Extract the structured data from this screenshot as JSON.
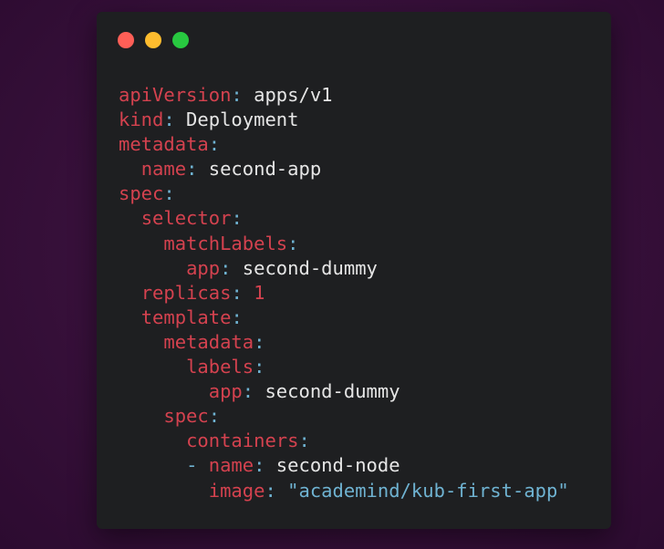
{
  "window": {
    "controls": {
      "close_color": "#fe5f57",
      "minimize_color": "#febc2e",
      "maximize_color": "#28c840"
    }
  },
  "code": {
    "colors": {
      "key": "#d4424f",
      "punct": "#6fb3d2",
      "value": "#e6e6e6",
      "string": "#6fb3d2",
      "number": "#d4424f"
    },
    "lines": [
      {
        "indent": "",
        "dash": "",
        "key": "apiVersion",
        "colon": ":",
        "value": " apps/v1",
        "vtype": "v"
      },
      {
        "indent": "",
        "dash": "",
        "key": "kind",
        "colon": ":",
        "value": " Deployment",
        "vtype": "v"
      },
      {
        "indent": "",
        "dash": "",
        "key": "metadata",
        "colon": ":",
        "value": "",
        "vtype": "v"
      },
      {
        "indent": "  ",
        "dash": "",
        "key": "name",
        "colon": ":",
        "value": " second-app",
        "vtype": "v"
      },
      {
        "indent": "",
        "dash": "",
        "key": "spec",
        "colon": ":",
        "value": "",
        "vtype": "v"
      },
      {
        "indent": "  ",
        "dash": "",
        "key": "selector",
        "colon": ":",
        "value": "",
        "vtype": "v"
      },
      {
        "indent": "    ",
        "dash": "",
        "key": "matchLabels",
        "colon": ":",
        "value": "",
        "vtype": "v"
      },
      {
        "indent": "      ",
        "dash": "",
        "key": "app",
        "colon": ":",
        "value": " second-dummy",
        "vtype": "v"
      },
      {
        "indent": "  ",
        "dash": "",
        "key": "replicas",
        "colon": ":",
        "value": " 1",
        "vtype": "n"
      },
      {
        "indent": "  ",
        "dash": "",
        "key": "template",
        "colon": ":",
        "value": "",
        "vtype": "v"
      },
      {
        "indent": "    ",
        "dash": "",
        "key": "metadata",
        "colon": ":",
        "value": "",
        "vtype": "v"
      },
      {
        "indent": "      ",
        "dash": "",
        "key": "labels",
        "colon": ":",
        "value": "",
        "vtype": "v"
      },
      {
        "indent": "        ",
        "dash": "",
        "key": "app",
        "colon": ":",
        "value": " second-dummy",
        "vtype": "v"
      },
      {
        "indent": "    ",
        "dash": "",
        "key": "spec",
        "colon": ":",
        "value": "",
        "vtype": "v"
      },
      {
        "indent": "      ",
        "dash": "",
        "key": "containers",
        "colon": ":",
        "value": "",
        "vtype": "v"
      },
      {
        "indent": "      ",
        "dash": "- ",
        "key": "name",
        "colon": ":",
        "value": " second-node",
        "vtype": "v"
      },
      {
        "indent": "        ",
        "dash": "",
        "key": "image",
        "colon": ":",
        "value": " \"academind/kub-first-app\"",
        "vtype": "s"
      }
    ]
  }
}
